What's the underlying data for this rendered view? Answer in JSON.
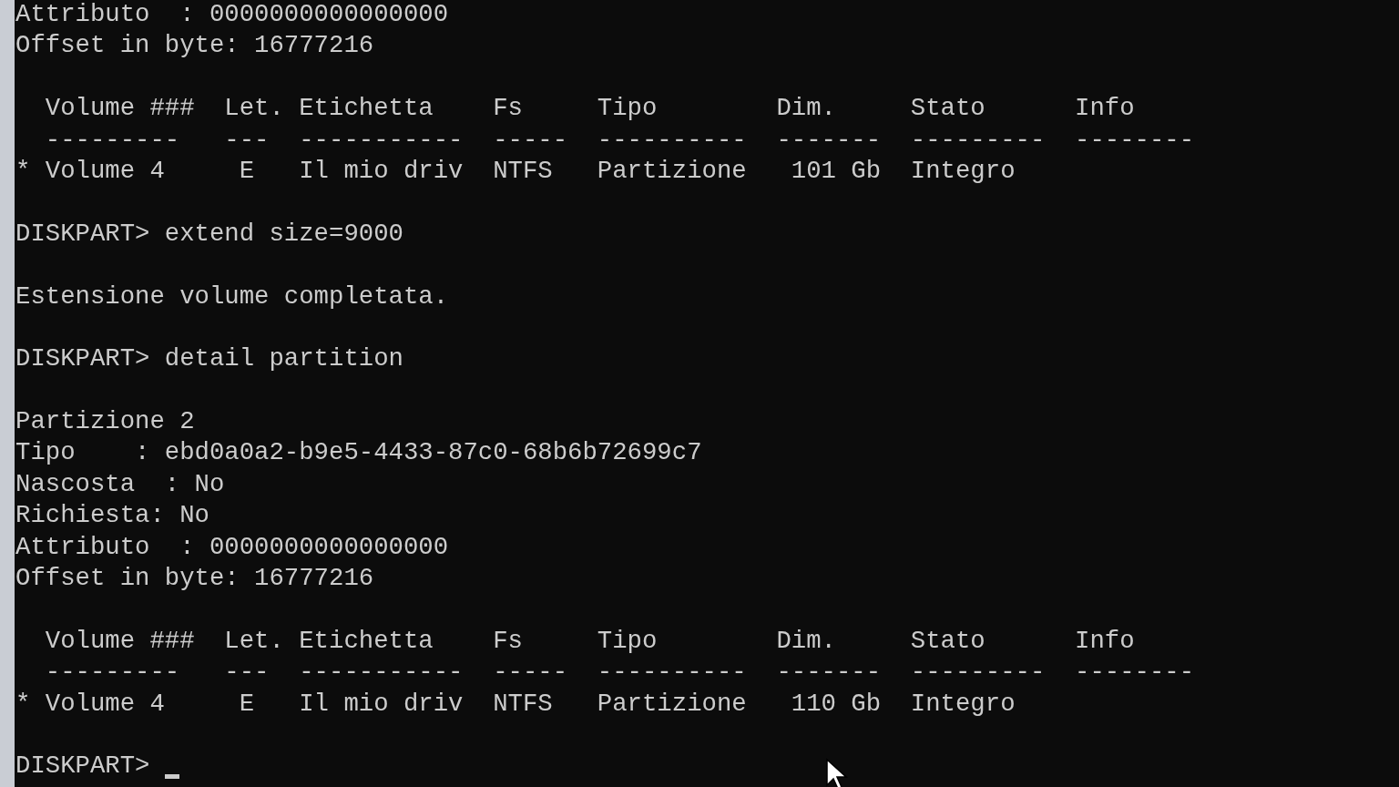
{
  "terminal": {
    "blocks": [
      {
        "lines": [
          "Attributo  : 0000000000000000",
          "Offset in byte: 16777216"
        ]
      },
      {
        "lines": [
          "  Volume ###  Let. Etichetta    Fs     Tipo        Dim.     Stato      Info",
          "  ---------   ---  -----------  -----  ----------  -------  ---------  --------",
          "* Volume 4     E   Il mio driv  NTFS   Partizione   101 Gb  Integro"
        ]
      },
      {
        "lines": [
          "DISKPART> extend size=9000"
        ]
      },
      {
        "lines": [
          "Estensione volume completata."
        ]
      },
      {
        "lines": [
          "DISKPART> detail partition"
        ]
      },
      {
        "lines": [
          "Partizione 2",
          "Tipo    : ebd0a0a2-b9e5-4433-87c0-68b6b72699c7",
          "Nascosta  : No",
          "Richiesta: No",
          "Attributo  : 0000000000000000",
          "Offset in byte: 16777216"
        ]
      },
      {
        "lines": [
          "  Volume ###  Let. Etichetta    Fs     Tipo        Dim.     Stato      Info",
          "  ---------   ---  -----------  -----  ----------  -------  ---------  --------",
          "* Volume 4     E   Il mio driv  NTFS   Partizione   110 Gb  Integro"
        ]
      }
    ],
    "prompt": {
      "text": "DISKPART>",
      "cursor": true
    }
  }
}
